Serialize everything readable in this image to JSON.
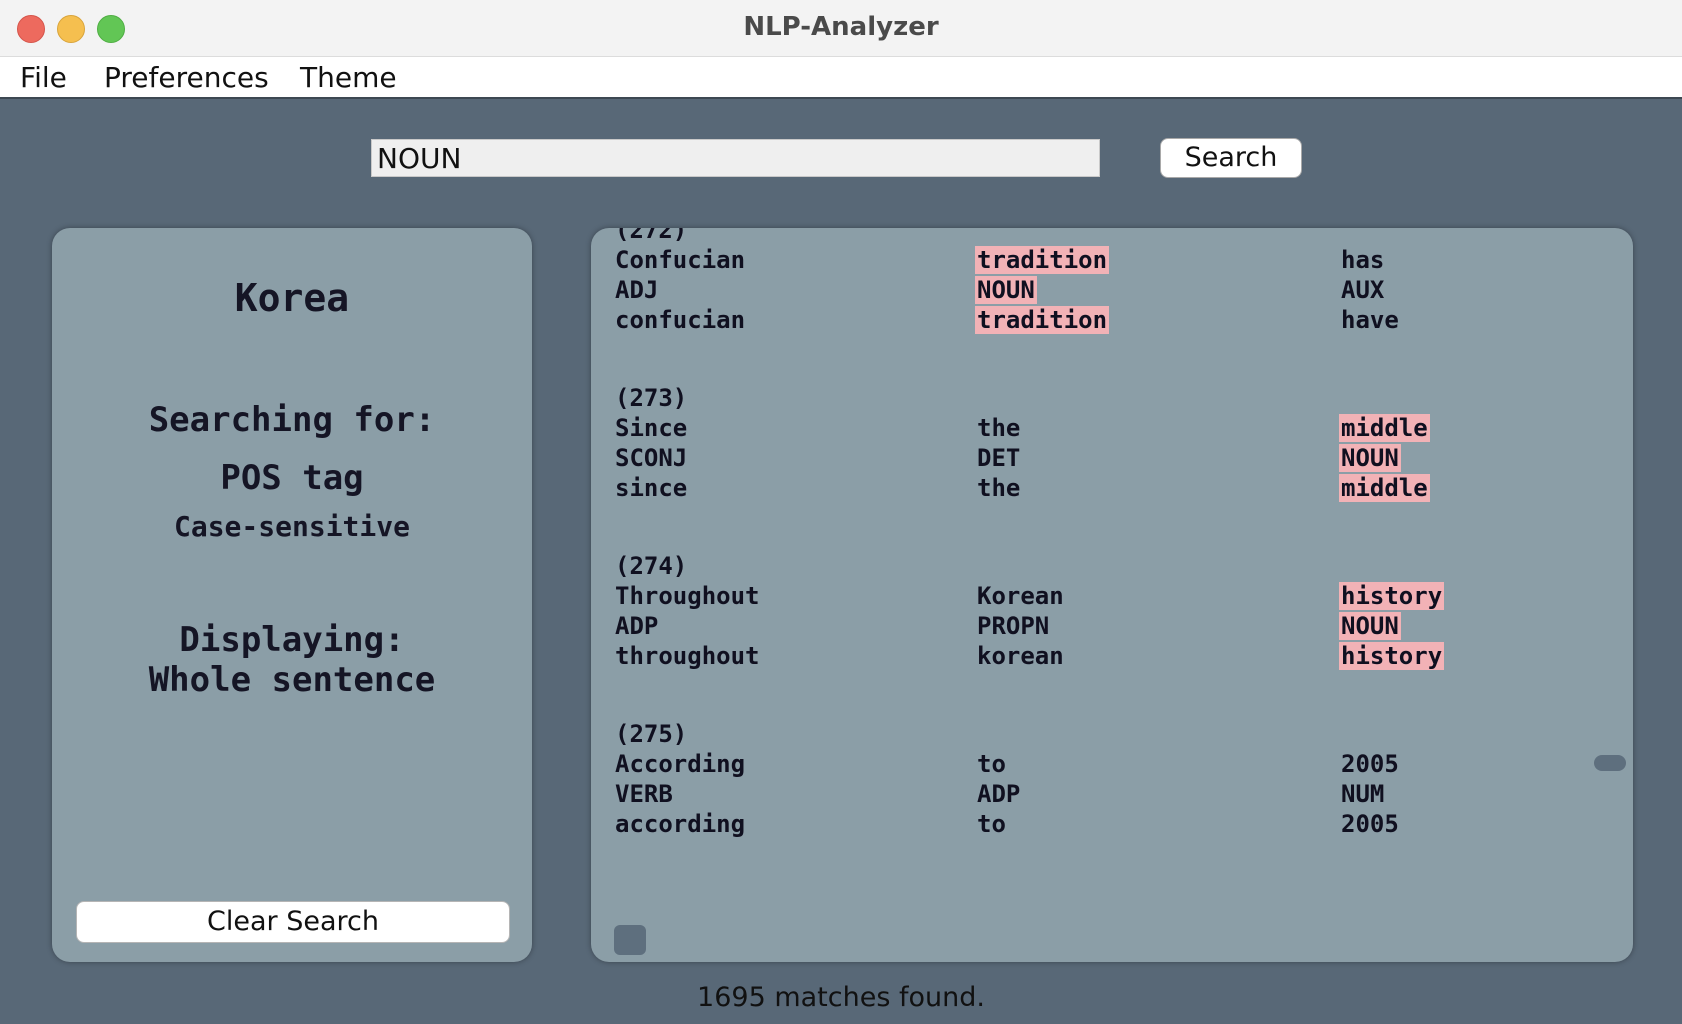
{
  "window": {
    "title": "NLP-Analyzer"
  },
  "menu": {
    "file": "File",
    "preferences": "Preferences",
    "theme": "Theme"
  },
  "search": {
    "value": "NOUN",
    "button_label": "Search"
  },
  "info_panel": {
    "corpus": "Korea",
    "searching_for_label": "Searching for:",
    "search_type": "POS tag",
    "case_mode": "Case-sensitive",
    "displaying_label": "Displaying:",
    "display_mode": "Whole sentence",
    "clear_button_label": "Clear Search"
  },
  "results": [
    {
      "number": "(272)",
      "tokens": [
        {
          "word": "Confucian",
          "pos": "ADJ",
          "lemma": "confucian",
          "match": false
        },
        {
          "word": "tradition",
          "pos": "NOUN",
          "lemma": "tradition",
          "match": true
        },
        {
          "word": "has",
          "pos": "AUX",
          "lemma": "have",
          "match": false
        }
      ]
    },
    {
      "number": "(273)",
      "tokens": [
        {
          "word": "Since",
          "pos": "SCONJ",
          "lemma": "since",
          "match": false
        },
        {
          "word": "the",
          "pos": "DET",
          "lemma": "the",
          "match": false
        },
        {
          "word": "middle",
          "pos": "NOUN",
          "lemma": "middle",
          "match": true
        }
      ]
    },
    {
      "number": "(274)",
      "tokens": [
        {
          "word": "Throughout",
          "pos": "ADP",
          "lemma": "throughout",
          "match": false
        },
        {
          "word": "Korean",
          "pos": "PROPN",
          "lemma": "korean",
          "match": false
        },
        {
          "word": "history",
          "pos": "NOUN",
          "lemma": "history",
          "match": true
        }
      ]
    },
    {
      "number": "(275)",
      "tokens": [
        {
          "word": "According",
          "pos": "VERB",
          "lemma": "according",
          "match": false
        },
        {
          "word": "to",
          "pos": "ADP",
          "lemma": "to",
          "match": false
        },
        {
          "word": "2005",
          "pos": "NUM",
          "lemma": "2005",
          "match": false
        }
      ]
    }
  ],
  "status": {
    "text": "1695 matches found."
  },
  "colors": {
    "match_highlight": "#f2b2b6",
    "panel": "#8b9ea7",
    "background": "#586877"
  }
}
